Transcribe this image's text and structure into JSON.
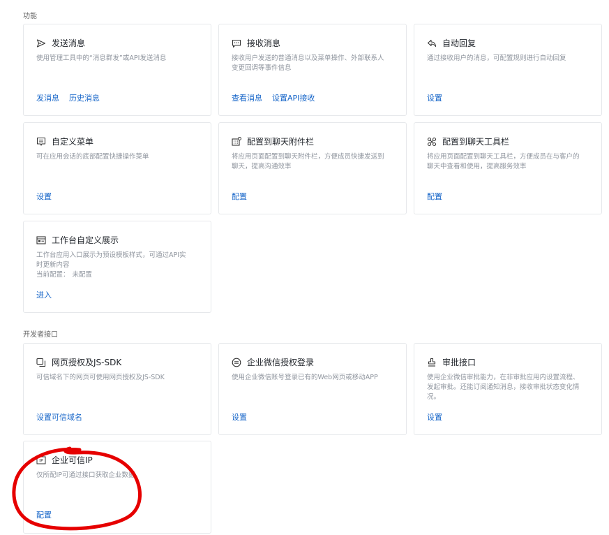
{
  "sections": {
    "features_label": "功能",
    "developer_label": "开发者接口"
  },
  "cards": {
    "send_message": {
      "title": "发送消息",
      "desc": "使用管理工具中的“消息群发”或API发送消息",
      "links": [
        "发消息",
        "历史消息"
      ]
    },
    "receive_message": {
      "title": "接收消息",
      "desc_lines": [
        "接收用户发送的普通消息以及菜单操作、外部联系人",
        "变更回调等事件信息"
      ],
      "links": [
        "查看消息",
        "设置API接收"
      ]
    },
    "auto_reply": {
      "title": "自动回复",
      "desc": "通过接收用户的消息，可配置规则进行自动回复",
      "links": [
        "设置"
      ]
    },
    "custom_menu": {
      "title": "自定义菜单",
      "desc": "可在应用会话的底部配置快捷操作菜单",
      "links": [
        "设置"
      ]
    },
    "chat_attachment_bar": {
      "title": "配置到聊天附件栏",
      "desc_lines": [
        "将应用页面配置到聊天附件栏，方便成员快捷发送到",
        "聊天，提高沟通效率"
      ],
      "links": [
        "配置"
      ]
    },
    "chat_toolbar": {
      "title": "配置到聊天工具栏",
      "desc_lines": [
        "将应用页面配置到聊天工具栏，方便成员在与客户的",
        "聊天中查看和使用，提高服务效率"
      ],
      "links": [
        "配置"
      ]
    },
    "workbench_display": {
      "title": "工作台自定义展示",
      "desc_lines": [
        "工作台应用入口展示为预设模板样式，可通过API实",
        "时更新内容"
      ],
      "config_label": "当前配置：",
      "config_value": "未配置",
      "links": [
        "进入"
      ]
    },
    "web_auth_jssdk": {
      "title": "网页授权及JS-SDK",
      "desc": "可信域名下的网页可使用网页授权及JS-SDK",
      "links": [
        "设置可信域名"
      ]
    },
    "wecom_auth_login": {
      "title": "企业微信授权登录",
      "desc": "使用企业微信账号登录已有的Web网页或移动APP",
      "links": [
        "设置"
      ]
    },
    "approval_api": {
      "title": "审批接口",
      "desc_lines": [
        "使用企业微信审批能力，在非审批应用内设置流程、",
        "发起审批。还能订阅通知消息，接收审批状态变化情",
        "况。"
      ],
      "links": [
        "设置"
      ]
    },
    "trusted_ip": {
      "title": "企业可信IP",
      "desc": "仅所配IP可通过接口获取企业数据",
      "links": [
        "配置"
      ]
    }
  },
  "colors": {
    "link": "#1464c8",
    "annotation": "#e60000",
    "border": "#e6e8eb"
  }
}
